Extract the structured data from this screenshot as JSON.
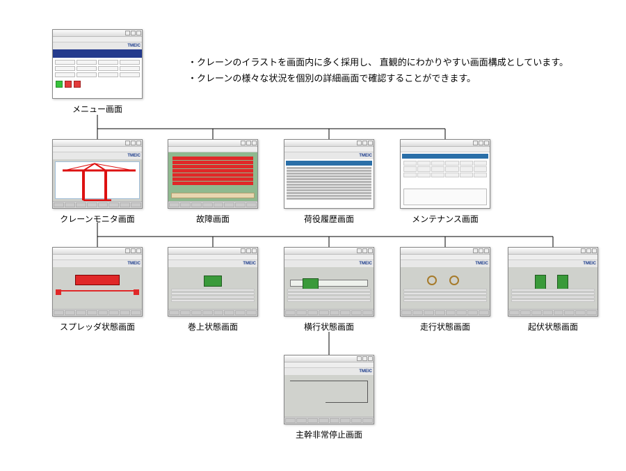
{
  "brand": "TMEIC",
  "description": {
    "line1": "・クレーンのイラストを画面内に多く採用し、 直観的にわかりやすい画面構成としています。",
    "line2": "・クレーンの様々な状況を個別の詳細画面で確認することができます。"
  },
  "screens": {
    "menu": {
      "label": "メニュー画面"
    },
    "monitor": {
      "label": "クレーンモニタ画面"
    },
    "fault": {
      "label": "故障画面"
    },
    "history": {
      "label": "荷役履歴画面"
    },
    "maintenance": {
      "label": "メンテナンス画面"
    },
    "spreader": {
      "label": "スプレッダ状態画面"
    },
    "hoist": {
      "label": "巻上状態画面"
    },
    "traverse": {
      "label": "横行状態画面"
    },
    "travel": {
      "label": "走行状態画面"
    },
    "luffing": {
      "label": "起伏状態画面"
    },
    "estop": {
      "label": "主幹非常停止画面"
    }
  }
}
